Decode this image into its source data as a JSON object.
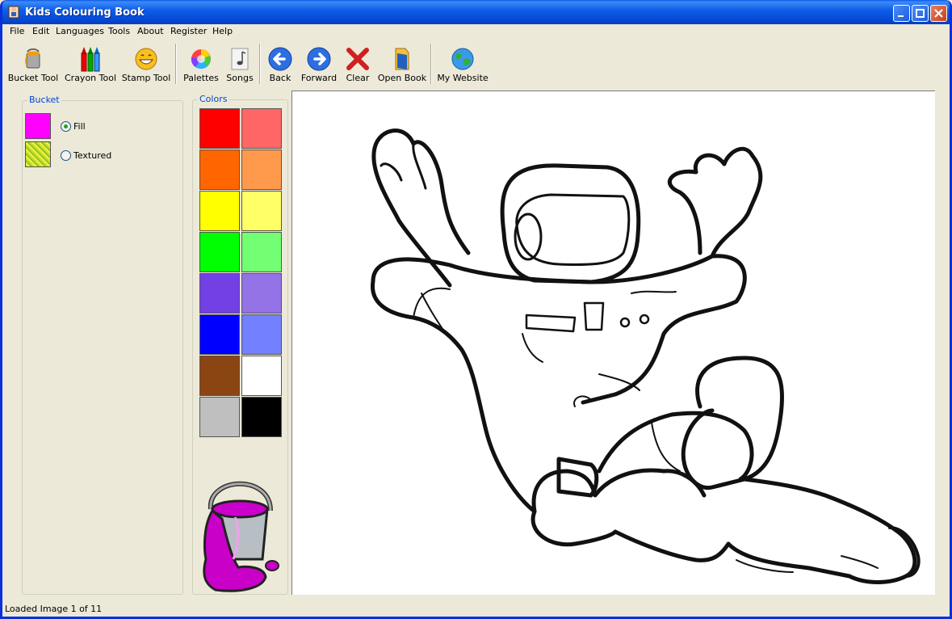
{
  "window": {
    "title": "Kids Colouring Book"
  },
  "menu": [
    "File",
    "Edit",
    "Languages",
    "Tools",
    "About",
    "Register",
    "Help"
  ],
  "toolbar": {
    "bucket": "Bucket Tool",
    "crayon": "Crayon Tool",
    "stamp": "Stamp Tool",
    "palettes": "Palettes",
    "songs": "Songs",
    "back": "Back",
    "forward": "Forward",
    "clear": "Clear",
    "open_book": "Open Book",
    "website": "My Website"
  },
  "bucket_panel": {
    "title": "Bucket",
    "fill_label": "Fill",
    "textured_label": "Textured",
    "selected_mode": "Fill",
    "current_color": "#ff00ff"
  },
  "colors_panel": {
    "title": "Colors",
    "palette": [
      "#ff0000",
      "#ff6666",
      "#ff6600",
      "#ff9a4d",
      "#ffff00",
      "#ffff66",
      "#00ff00",
      "#73ff73",
      "#7340e6",
      "#9473e6",
      "#0000ff",
      "#7380ff",
      "#8a4513",
      "#ffffff",
      "#bfbfbf",
      "#000000"
    ]
  },
  "status": {
    "text": "Loaded Image 1 of 11"
  }
}
